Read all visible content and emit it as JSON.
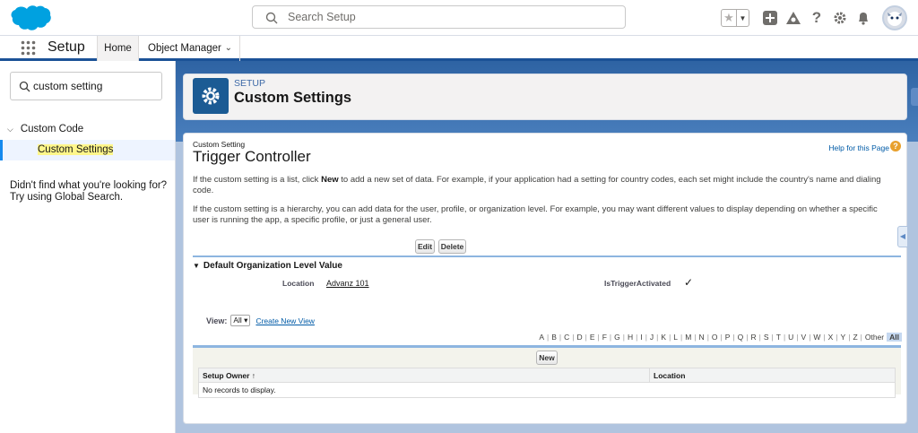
{
  "header": {
    "search_placeholder": "Search Setup"
  },
  "nav": {
    "app_name": "Setup",
    "tabs": [
      {
        "label": "Home"
      },
      {
        "label": "Object Manager"
      }
    ]
  },
  "sidebar": {
    "quick_find_value": "custom setting",
    "tree_parent": "Custom Code",
    "tree_child": "Custom Settings",
    "not_found_text": "Didn't find what you're looking for? Try using Global Search."
  },
  "page_header": {
    "eyebrow": "SETUP",
    "title": "Custom Settings"
  },
  "detail": {
    "type_label": "Custom Setting",
    "name": "Trigger Controller",
    "help_link": "Help for this Page",
    "para1_pre": "If the custom setting is a list, click ",
    "para1_bold": "New",
    "para1_post": " to add a new set of data. For example, if your application had a setting for country codes, each set might include the country's name and dialing code.",
    "para2": "If the custom setting is a hierarchy, you can add data for the user, profile, or organization level. For example, you may want different values to display depending on whether a specific user is running the app, a specific profile, or just a general user.",
    "edit_button": "Edit",
    "delete_button": "Delete",
    "section_title": "Default Organization Level Value",
    "fields": {
      "location_label": "Location",
      "location_value": "Advanz 101",
      "trigger_label": "IsTriggerActivated",
      "trigger_checked": true
    },
    "view_label": "View:",
    "view_select": "All",
    "create_view_link": "Create New View",
    "alpha_letters": [
      "A",
      "B",
      "C",
      "D",
      "E",
      "F",
      "G",
      "H",
      "I",
      "J",
      "K",
      "L",
      "M",
      "N",
      "O",
      "P",
      "Q",
      "R",
      "S",
      "T",
      "U",
      "V",
      "W",
      "X",
      "Y",
      "Z",
      "Other"
    ],
    "alpha_active": "All",
    "new_button": "New",
    "columns": [
      "Setup Owner ↑",
      "Location"
    ],
    "empty_text": "No records to display."
  },
  "colors": {
    "brand_blue": "#1b5297",
    "link_blue": "#015ba7",
    "highlight_yellow": "#fff68a"
  }
}
